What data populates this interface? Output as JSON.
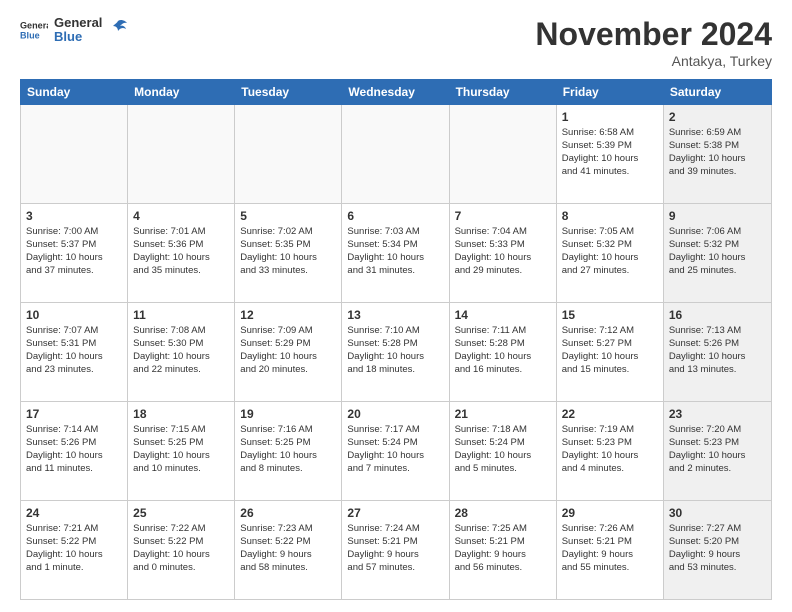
{
  "logo": {
    "general": "General",
    "blue": "Blue"
  },
  "title": "November 2024",
  "location": "Antakya, Turkey",
  "days": [
    "Sunday",
    "Monday",
    "Tuesday",
    "Wednesday",
    "Thursday",
    "Friday",
    "Saturday"
  ],
  "weeks": [
    [
      {
        "day": "",
        "info": "",
        "empty": true
      },
      {
        "day": "",
        "info": "",
        "empty": true
      },
      {
        "day": "",
        "info": "",
        "empty": true
      },
      {
        "day": "",
        "info": "",
        "empty": true
      },
      {
        "day": "",
        "info": "",
        "empty": true
      },
      {
        "day": "1",
        "info": "Sunrise: 6:58 AM\nSunset: 5:39 PM\nDaylight: 10 hours\nand 41 minutes.",
        "empty": false,
        "shaded": false
      },
      {
        "day": "2",
        "info": "Sunrise: 6:59 AM\nSunset: 5:38 PM\nDaylight: 10 hours\nand 39 minutes.",
        "empty": false,
        "shaded": true
      }
    ],
    [
      {
        "day": "3",
        "info": "Sunrise: 7:00 AM\nSunset: 5:37 PM\nDaylight: 10 hours\nand 37 minutes.",
        "empty": false,
        "shaded": false
      },
      {
        "day": "4",
        "info": "Sunrise: 7:01 AM\nSunset: 5:36 PM\nDaylight: 10 hours\nand 35 minutes.",
        "empty": false,
        "shaded": false
      },
      {
        "day": "5",
        "info": "Sunrise: 7:02 AM\nSunset: 5:35 PM\nDaylight: 10 hours\nand 33 minutes.",
        "empty": false,
        "shaded": false
      },
      {
        "day": "6",
        "info": "Sunrise: 7:03 AM\nSunset: 5:34 PM\nDaylight: 10 hours\nand 31 minutes.",
        "empty": false,
        "shaded": false
      },
      {
        "day": "7",
        "info": "Sunrise: 7:04 AM\nSunset: 5:33 PM\nDaylight: 10 hours\nand 29 minutes.",
        "empty": false,
        "shaded": false
      },
      {
        "day": "8",
        "info": "Sunrise: 7:05 AM\nSunset: 5:32 PM\nDaylight: 10 hours\nand 27 minutes.",
        "empty": false,
        "shaded": false
      },
      {
        "day": "9",
        "info": "Sunrise: 7:06 AM\nSunset: 5:32 PM\nDaylight: 10 hours\nand 25 minutes.",
        "empty": false,
        "shaded": true
      }
    ],
    [
      {
        "day": "10",
        "info": "Sunrise: 7:07 AM\nSunset: 5:31 PM\nDaylight: 10 hours\nand 23 minutes.",
        "empty": false,
        "shaded": false
      },
      {
        "day": "11",
        "info": "Sunrise: 7:08 AM\nSunset: 5:30 PM\nDaylight: 10 hours\nand 22 minutes.",
        "empty": false,
        "shaded": false
      },
      {
        "day": "12",
        "info": "Sunrise: 7:09 AM\nSunset: 5:29 PM\nDaylight: 10 hours\nand 20 minutes.",
        "empty": false,
        "shaded": false
      },
      {
        "day": "13",
        "info": "Sunrise: 7:10 AM\nSunset: 5:28 PM\nDaylight: 10 hours\nand 18 minutes.",
        "empty": false,
        "shaded": false
      },
      {
        "day": "14",
        "info": "Sunrise: 7:11 AM\nSunset: 5:28 PM\nDaylight: 10 hours\nand 16 minutes.",
        "empty": false,
        "shaded": false
      },
      {
        "day": "15",
        "info": "Sunrise: 7:12 AM\nSunset: 5:27 PM\nDaylight: 10 hours\nand 15 minutes.",
        "empty": false,
        "shaded": false
      },
      {
        "day": "16",
        "info": "Sunrise: 7:13 AM\nSunset: 5:26 PM\nDaylight: 10 hours\nand 13 minutes.",
        "empty": false,
        "shaded": true
      }
    ],
    [
      {
        "day": "17",
        "info": "Sunrise: 7:14 AM\nSunset: 5:26 PM\nDaylight: 10 hours\nand 11 minutes.",
        "empty": false,
        "shaded": false
      },
      {
        "day": "18",
        "info": "Sunrise: 7:15 AM\nSunset: 5:25 PM\nDaylight: 10 hours\nand 10 minutes.",
        "empty": false,
        "shaded": false
      },
      {
        "day": "19",
        "info": "Sunrise: 7:16 AM\nSunset: 5:25 PM\nDaylight: 10 hours\nand 8 minutes.",
        "empty": false,
        "shaded": false
      },
      {
        "day": "20",
        "info": "Sunrise: 7:17 AM\nSunset: 5:24 PM\nDaylight: 10 hours\nand 7 minutes.",
        "empty": false,
        "shaded": false
      },
      {
        "day": "21",
        "info": "Sunrise: 7:18 AM\nSunset: 5:24 PM\nDaylight: 10 hours\nand 5 minutes.",
        "empty": false,
        "shaded": false
      },
      {
        "day": "22",
        "info": "Sunrise: 7:19 AM\nSunset: 5:23 PM\nDaylight: 10 hours\nand 4 minutes.",
        "empty": false,
        "shaded": false
      },
      {
        "day": "23",
        "info": "Sunrise: 7:20 AM\nSunset: 5:23 PM\nDaylight: 10 hours\nand 2 minutes.",
        "empty": false,
        "shaded": true
      }
    ],
    [
      {
        "day": "24",
        "info": "Sunrise: 7:21 AM\nSunset: 5:22 PM\nDaylight: 10 hours\nand 1 minute.",
        "empty": false,
        "shaded": false
      },
      {
        "day": "25",
        "info": "Sunrise: 7:22 AM\nSunset: 5:22 PM\nDaylight: 10 hours\nand 0 minutes.",
        "empty": false,
        "shaded": false
      },
      {
        "day": "26",
        "info": "Sunrise: 7:23 AM\nSunset: 5:22 PM\nDaylight: 9 hours\nand 58 minutes.",
        "empty": false,
        "shaded": false
      },
      {
        "day": "27",
        "info": "Sunrise: 7:24 AM\nSunset: 5:21 PM\nDaylight: 9 hours\nand 57 minutes.",
        "empty": false,
        "shaded": false
      },
      {
        "day": "28",
        "info": "Sunrise: 7:25 AM\nSunset: 5:21 PM\nDaylight: 9 hours\nand 56 minutes.",
        "empty": false,
        "shaded": false
      },
      {
        "day": "29",
        "info": "Sunrise: 7:26 AM\nSunset: 5:21 PM\nDaylight: 9 hours\nand 55 minutes.",
        "empty": false,
        "shaded": false
      },
      {
        "day": "30",
        "info": "Sunrise: 7:27 AM\nSunset: 5:20 PM\nDaylight: 9 hours\nand 53 minutes.",
        "empty": false,
        "shaded": true
      }
    ]
  ]
}
